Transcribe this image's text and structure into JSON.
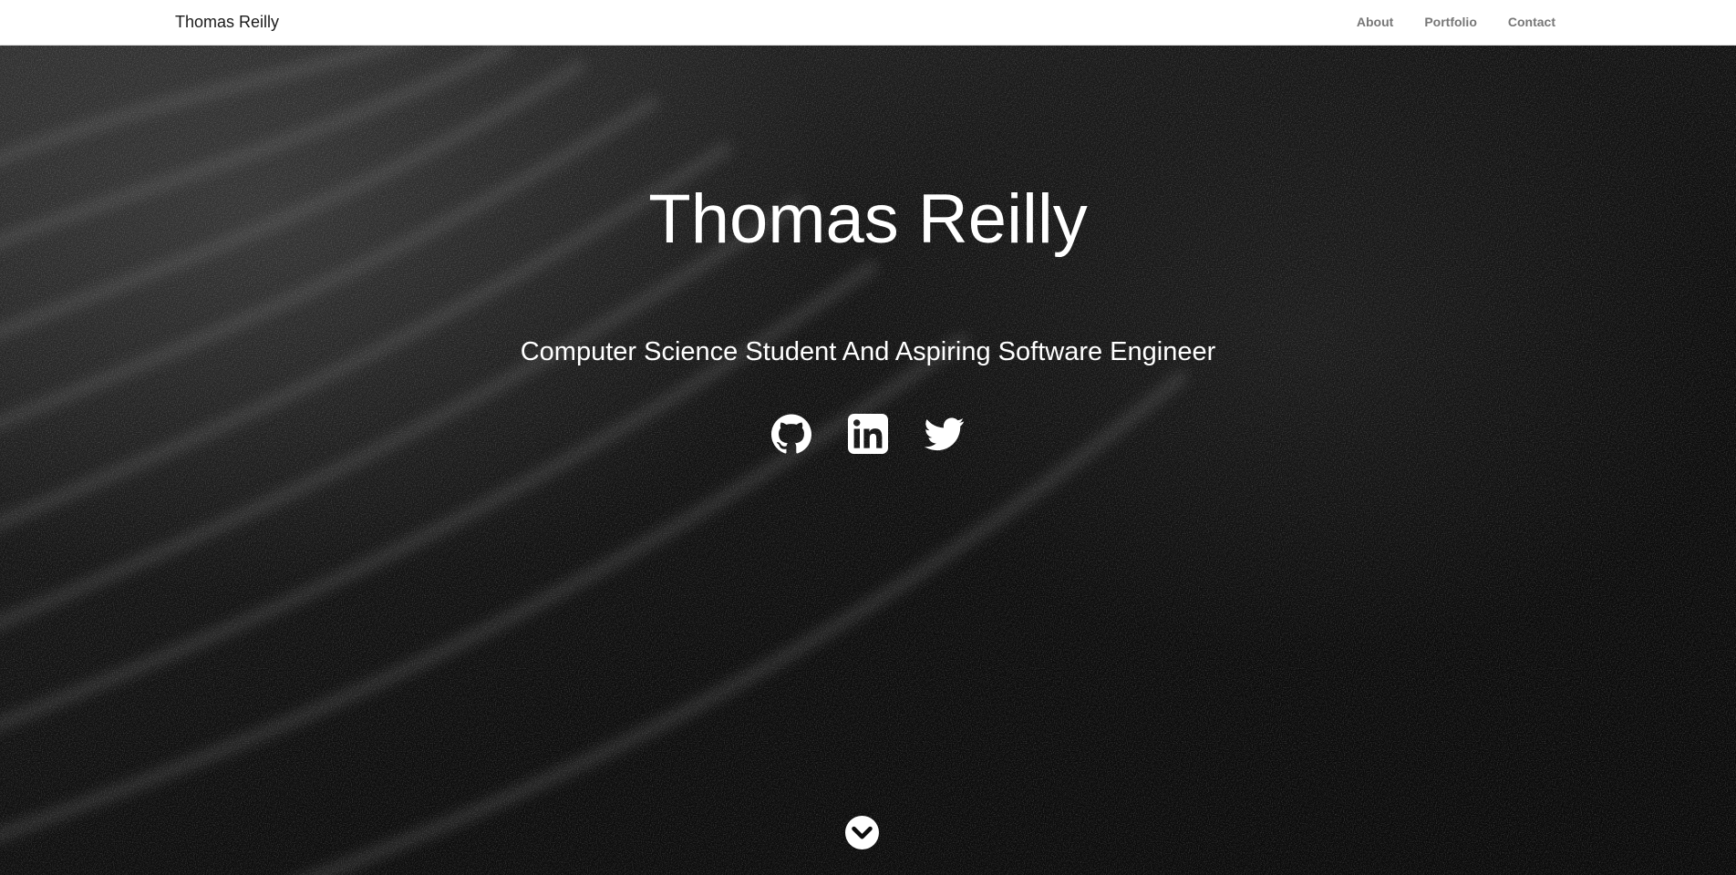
{
  "nav": {
    "brand": "Thomas Reilly",
    "links": [
      {
        "label": "About"
      },
      {
        "label": "Portfolio"
      },
      {
        "label": "Contact"
      }
    ]
  },
  "hero": {
    "title": "Thomas Reilly",
    "subtitle": "Computer Science Student And Aspiring Software Engineer",
    "social": [
      {
        "icon": "github-icon"
      },
      {
        "icon": "linkedin-icon"
      },
      {
        "icon": "twitter-icon"
      }
    ],
    "scroll_icon": "chevron-down-circle-icon"
  },
  "colors": {
    "nav_background": "#ffffff",
    "nav_link": "#777777",
    "brand_text": "#1a1a1a",
    "hero_text": "#ffffff",
    "hero_background": "#0d0d0d"
  }
}
